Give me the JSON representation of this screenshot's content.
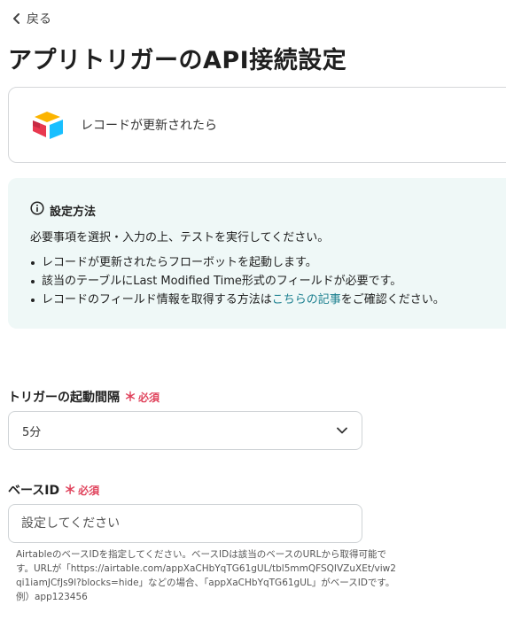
{
  "back": {
    "label": "戻る"
  },
  "page_title": "アプリトリガーのAPI接続設定",
  "app_card": {
    "label": "レコードが更新されたら"
  },
  "info": {
    "heading": "設定方法",
    "description": "必要事項を選択・入力の上、テストを実行してください。",
    "bullets": [
      "レコードが更新されたらフローボットを起動します。",
      "該当のテーブルにLast Modified Time形式のフィールドが必要です。"
    ],
    "bullet3_prefix": "レコードのフィールド情報を取得する方法は",
    "bullet3_link": "こちらの記事",
    "bullet3_suffix": "をご確認ください。"
  },
  "trigger_interval": {
    "label": "トリガーの起動間隔",
    "required_mark": "＊",
    "required_text": "必須",
    "selected": "5分"
  },
  "base_id": {
    "label": "ベースID",
    "required_mark": "＊",
    "required_text": "必須",
    "placeholder": "設定してください",
    "help": "AirtableのベースIDを指定してください。ベースIDは該当のベースのURLから取得可能です。URLが「https://airtable.com/appXaCHbYqTG61gUL/tbl5mmQFSQIVZuXEt/viw2qi1iamJCfJs9l?blocks=hide」などの場合、「appXaCHbYqTG61gUL」がベースIDです。例）app123456"
  },
  "colors": {
    "accent_link": "#1b7f8f",
    "required": "#e0445d",
    "info_bg": "#eff8f7"
  }
}
